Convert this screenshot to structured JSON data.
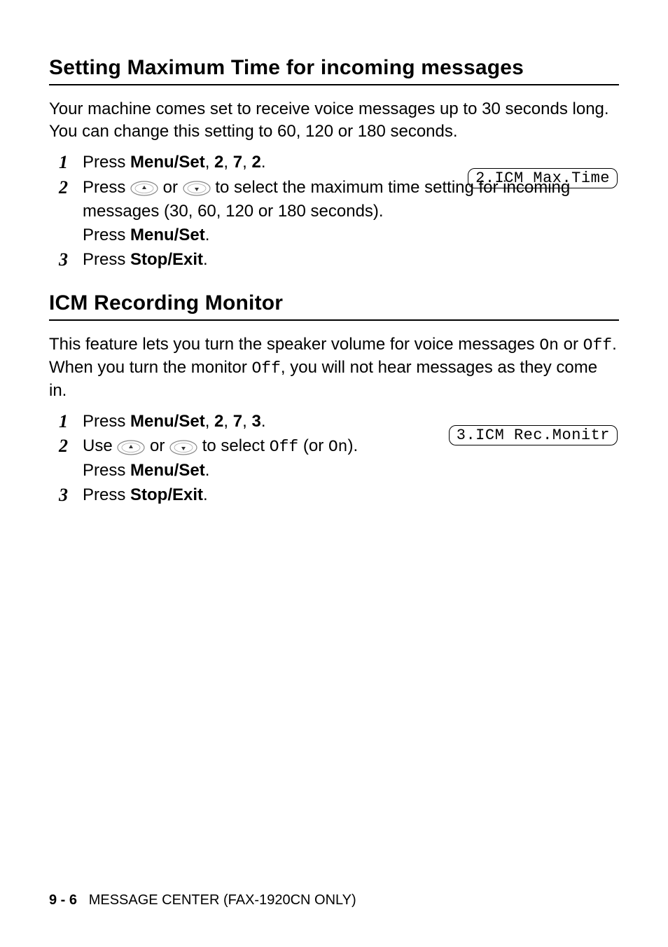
{
  "section1": {
    "heading": "Setting Maximum Time for incoming messages",
    "intro": "Your machine comes set to receive voice messages up to 30 seconds long. You can change this setting to 60, 120 or 180 seconds.",
    "lcd": "2.ICM Max.Time",
    "steps": {
      "s1_prefix": "Press ",
      "s1_bold": "Menu/Set",
      "s1_k1": "2",
      "s1_k2": "7",
      "s1_k3": "2",
      "s2_pre": "Press ",
      "s2_mid": " or ",
      "s2_post1": " to select the maximum time setting for incoming messages (30, 60, 120 or 180 seconds).",
      "s2_line2_pre": "Press ",
      "s2_line2_bold": "Menu/Set",
      "s3_pre": "Press ",
      "s3_bold": "Stop/Exit"
    }
  },
  "section2": {
    "heading": "ICM Recording Monitor",
    "intro_pre": "This feature lets you turn the speaker volume for voice messages ",
    "intro_on": "On",
    "intro_mid": " or ",
    "intro_off": "Off",
    "intro_post1": ". When you turn the monitor ",
    "intro_off2": "Off",
    "intro_post2": ", you will not hear messages as they come in.",
    "lcd": "3.ICM Rec.Monitr",
    "steps": {
      "s1_prefix": "Press ",
      "s1_bold": "Menu/Set",
      "s1_k1": "2",
      "s1_k2": "7",
      "s1_k3": "3",
      "s2_pre": "Use ",
      "s2_mid": " or ",
      "s2_post_a": " to select ",
      "s2_off": "Off",
      "s2_post_b": " (or ",
      "s2_on": "On",
      "s2_post_c": ").",
      "s2_line2_pre": "Press ",
      "s2_line2_bold": "Menu/Set",
      "s3_pre": "Press ",
      "s3_bold": "Stop/Exit"
    }
  },
  "footer": {
    "page": "9 - 6",
    "chapter": "MESSAGE CENTER (FAX-1920CN ONLY)"
  },
  "nums": {
    "n1": "1",
    "n2": "2",
    "n3": "3"
  }
}
